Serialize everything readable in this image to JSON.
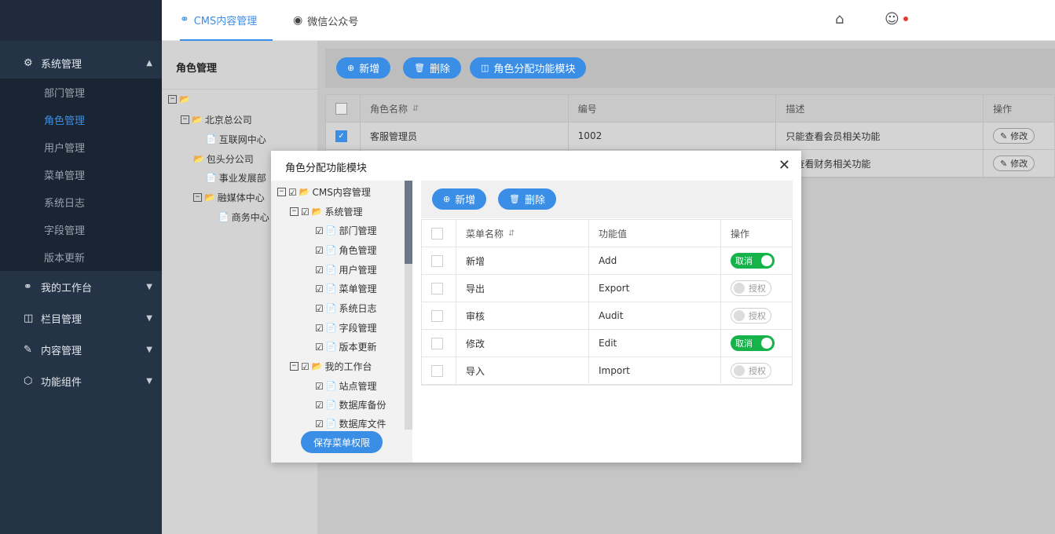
{
  "topbar": {
    "tabs": [
      {
        "label": "CMS内容管理",
        "icon": "globe-icon"
      },
      {
        "label": "微信公众号",
        "icon": "wechat-icon"
      }
    ],
    "icons": [
      "home-icon",
      "chat-icon"
    ]
  },
  "sidebar": {
    "groups": [
      {
        "label": "系统管理",
        "icon": "gear-icon",
        "expanded": true,
        "items": [
          {
            "label": "部门管理"
          },
          {
            "label": "角色管理",
            "active": true
          },
          {
            "label": "用户管理"
          },
          {
            "label": "菜单管理"
          },
          {
            "label": "系统日志"
          },
          {
            "label": "字段管理"
          },
          {
            "label": "版本更新"
          }
        ]
      },
      {
        "label": "我的工作台",
        "icon": "globe-icon"
      },
      {
        "label": "栏目管理",
        "icon": "columns-icon"
      },
      {
        "label": "内容管理",
        "icon": "edit-icon"
      },
      {
        "label": "功能组件",
        "icon": "cube-icon"
      }
    ]
  },
  "role_panel": {
    "title": "角色管理",
    "tree": [
      {
        "label": "北京总公司"
      },
      {
        "label": "互联网中心"
      },
      {
        "label": "包头分公司"
      },
      {
        "label": "事业发展部"
      },
      {
        "label": "融媒体中心"
      },
      {
        "label": "商务中心"
      }
    ]
  },
  "toolbar": {
    "add_label": "新增",
    "delete_label": "删除",
    "assign_label": "角色分配功能模块"
  },
  "role_table": {
    "headers": [
      "角色名称",
      "编号",
      "描述",
      "操作"
    ],
    "rows": [
      {
        "name": "客服管理员",
        "code": "1002",
        "desc": "只能查看会员相关功能",
        "action": "修改",
        "checked": true
      },
      {
        "name": "",
        "code": "",
        "desc": "能查看财务相关功能",
        "action": "修改",
        "checked": false
      }
    ]
  },
  "modal": {
    "title": "角色分配功能模块",
    "tree": [
      {
        "label": "CMS内容管理"
      },
      {
        "label": "系统管理"
      },
      {
        "label": "部门管理"
      },
      {
        "label": "角色管理"
      },
      {
        "label": "用户管理"
      },
      {
        "label": "菜单管理"
      },
      {
        "label": "系统日志"
      },
      {
        "label": "字段管理"
      },
      {
        "label": "版本更新"
      },
      {
        "label": "我的工作台"
      },
      {
        "label": "站点管理"
      },
      {
        "label": "数据库备份"
      },
      {
        "label": "数据库文件"
      }
    ],
    "save_label": "保存菜单权限",
    "add_label": "新增",
    "delete_label": "删除",
    "headers": [
      "菜单名称",
      "功能值",
      "操作"
    ],
    "rows": [
      {
        "name": "新增",
        "value": "Add",
        "toggle": "取消",
        "on": true
      },
      {
        "name": "导出",
        "value": "Export",
        "toggle": "授权",
        "on": false
      },
      {
        "name": "审核",
        "value": "Audit",
        "toggle": "授权",
        "on": false
      },
      {
        "name": "修改",
        "value": "Edit",
        "toggle": "取消",
        "on": true
      },
      {
        "name": "导入",
        "value": "Import",
        "toggle": "授权",
        "on": false
      }
    ]
  }
}
